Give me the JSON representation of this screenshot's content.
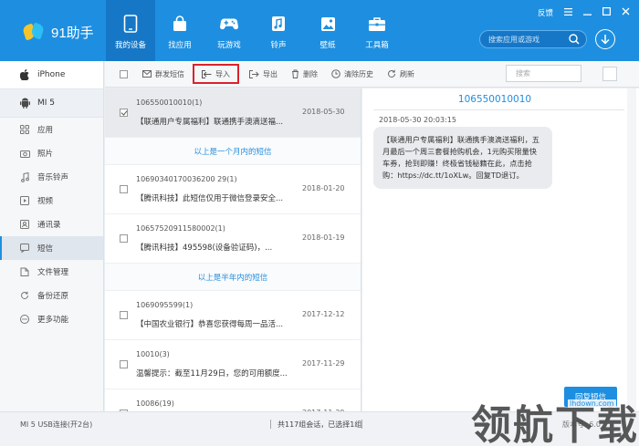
{
  "app": {
    "name": "91助手"
  },
  "topnav": [
    {
      "label": "我的设备",
      "icon": "phone-icon",
      "active": true
    },
    {
      "label": "找应用",
      "icon": "bag-icon"
    },
    {
      "label": "玩游戏",
      "icon": "gamepad-icon"
    },
    {
      "label": "铃声",
      "icon": "music-note-icon"
    },
    {
      "label": "壁纸",
      "icon": "picture-icon"
    },
    {
      "label": "工具箱",
      "icon": "toolbox-icon"
    }
  ],
  "window": {
    "feedback": "反馈"
  },
  "search": {
    "placeholder": "搜索应用或游戏"
  },
  "devices": [
    {
      "name": "iPhone",
      "icon": "apple-icon"
    },
    {
      "name": "MI 5",
      "icon": "android-icon"
    }
  ],
  "sidebar": {
    "items": [
      {
        "label": "应用",
        "icon": "apps-grid-icon"
      },
      {
        "label": "照片",
        "icon": "camera-icon"
      },
      {
        "label": "音乐铃声",
        "icon": "music-icon"
      },
      {
        "label": "视频",
        "icon": "video-icon"
      },
      {
        "label": "通讯录",
        "icon": "contacts-icon"
      },
      {
        "label": "短信",
        "icon": "sms-icon",
        "active": true
      },
      {
        "label": "文件管理",
        "icon": "folder-icon"
      },
      {
        "label": "备份还原",
        "icon": "backup-icon"
      },
      {
        "label": "更多功能",
        "icon": "more-icon"
      }
    ]
  },
  "toolbar": {
    "group_send": "群发短信",
    "import": "导入",
    "export": "导出",
    "delete": "删除",
    "clear_history": "清除历史",
    "refresh": "刷新",
    "search_placeholder": "搜索"
  },
  "messages": {
    "rows": [
      {
        "number": "106550010010(1)",
        "preview": "【联通用户专属福利】联通携手澳滴送福...",
        "date": "2018-05-30",
        "selected": true
      },
      {
        "divider": "以上是一个月内的短信"
      },
      {
        "number": "10690340170036200 29(1)",
        "preview": "【腾讯科技】此短信仅用于微信登录安全...",
        "date": "2018-01-20"
      },
      {
        "number": "10657520911580002(1)",
        "preview": "【腾讯科技】495598(设备验证码)，...",
        "date": "2018-01-19"
      },
      {
        "divider": "以上是半年内的短信"
      },
      {
        "number": "1069095599(1)",
        "preview": "【中国农业银行】恭喜您获得每周一品活...",
        "date": "2017-12-12"
      },
      {
        "number": "10010(3)",
        "preview": "温馨提示：截至11月29日，您的可用额度...",
        "date": "2017-11-29"
      },
      {
        "number": "10086(19)",
        "preview": "",
        "date": "2017-11-29"
      }
    ]
  },
  "conversation": {
    "title": "106550010010",
    "time": "2018-05-30 20:03:15",
    "body": "【联通用户专属福利】联通携手澳滴送福利，五月最后一个周三套餐抢购机会，1元购买限量快车券，抢到即赚！终极省钱秘籍在此，点击抢购：https://dc.tt/1oXLw。回复TD退订。",
    "reply_label": "回复短信"
  },
  "status": {
    "device": "MI 5  USB连接(开2台)",
    "summary": "共117组会话，已选择1组",
    "version": "版本号: 6.0"
  },
  "watermark": {
    "text": "领航下载",
    "site": "lhdown.com"
  }
}
